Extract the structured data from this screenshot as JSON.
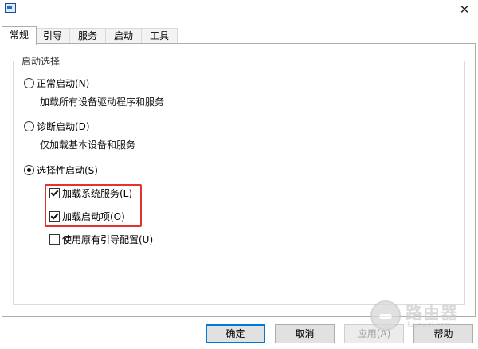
{
  "window": {
    "close_glyph": "✕",
    "app_icon": "msconfig-icon"
  },
  "tabs": [
    {
      "label": "常规",
      "active": true
    },
    {
      "label": "引导",
      "active": false
    },
    {
      "label": "服务",
      "active": false
    },
    {
      "label": "启动",
      "active": false
    },
    {
      "label": "工具",
      "active": false
    }
  ],
  "startup_selection": {
    "legend": "启动选择",
    "normal": {
      "label": "正常启动(N)",
      "desc": "加载所有设备驱动程序和服务",
      "checked": false
    },
    "diagnostic": {
      "label": "诊断启动(D)",
      "desc": "仅加载基本设备和服务",
      "checked": false
    },
    "selective": {
      "label": "选择性启动(S)",
      "checked": true
    },
    "options": [
      {
        "label": "加载系统服务(L)",
        "checked": true
      },
      {
        "label": "加载启动项(O)",
        "checked": true
      },
      {
        "label": "使用原有引导配置(U)",
        "checked": false
      }
    ]
  },
  "buttons": {
    "ok": "确定",
    "cancel": "取消",
    "apply": "应用(A)",
    "help": "帮助"
  },
  "watermark": {
    "title": "路由器",
    "subtitle": "luyouqi.com"
  },
  "colors": {
    "highlight": "#e4322f",
    "default_button_border": "#0078d7"
  }
}
